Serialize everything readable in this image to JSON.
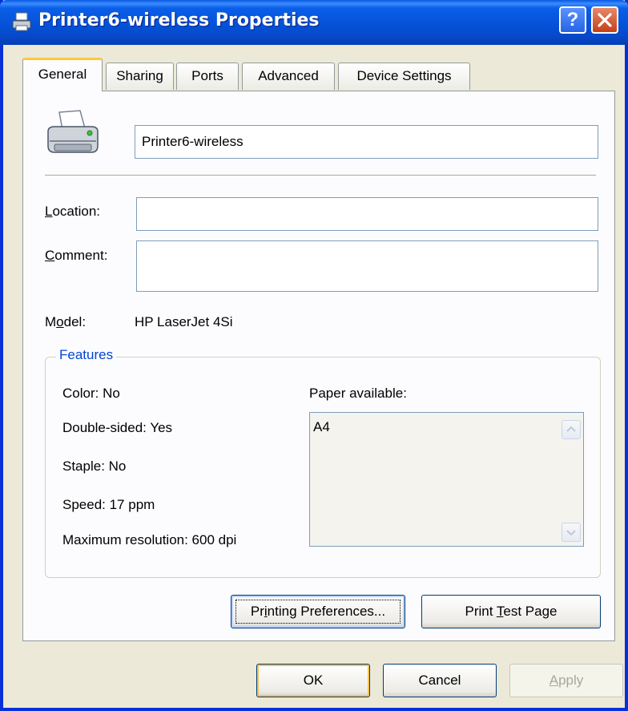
{
  "window": {
    "title": "Printer6-wireless Properties",
    "help_label": "?"
  },
  "tabs": [
    {
      "label": "General",
      "active": true
    },
    {
      "label": "Sharing",
      "active": false
    },
    {
      "label": "Ports",
      "active": false
    },
    {
      "label": "Advanced",
      "active": false
    },
    {
      "label": "Device Settings",
      "active": false
    }
  ],
  "general": {
    "printer_name": "Printer6-wireless",
    "location_label_accel": "L",
    "location_label_rest": "ocation:",
    "location_value": "",
    "comment_label_accel": "C",
    "comment_label_rest": "omment:",
    "comment_value": "",
    "model_label_pre": "M",
    "model_label_accel": "o",
    "model_label_post": "del:",
    "model_value": "HP LaserJet 4Si"
  },
  "features": {
    "title": "Features",
    "color": "Color: No",
    "double_sided": "Double-sided: Yes",
    "staple": "Staple: No",
    "speed": "Speed: 17 ppm",
    "max_resolution": "Maximum resolution: 600 dpi",
    "paper_label": "Paper available:",
    "paper_items": [
      "A4"
    ]
  },
  "buttons": {
    "prefs_pre": "Pr",
    "prefs_accel": "i",
    "prefs_post": "nting Preferences...",
    "test_pre": "Print ",
    "test_accel": "T",
    "test_post": "est Page",
    "ok": "OK",
    "cancel": "Cancel",
    "apply_accel": "A",
    "apply_post": "pply"
  },
  "colors": {
    "title_bar": "#0552d9",
    "tab_highlight": "#ffc73c",
    "group_title": "#0046d5",
    "face": "#ece9d8"
  }
}
